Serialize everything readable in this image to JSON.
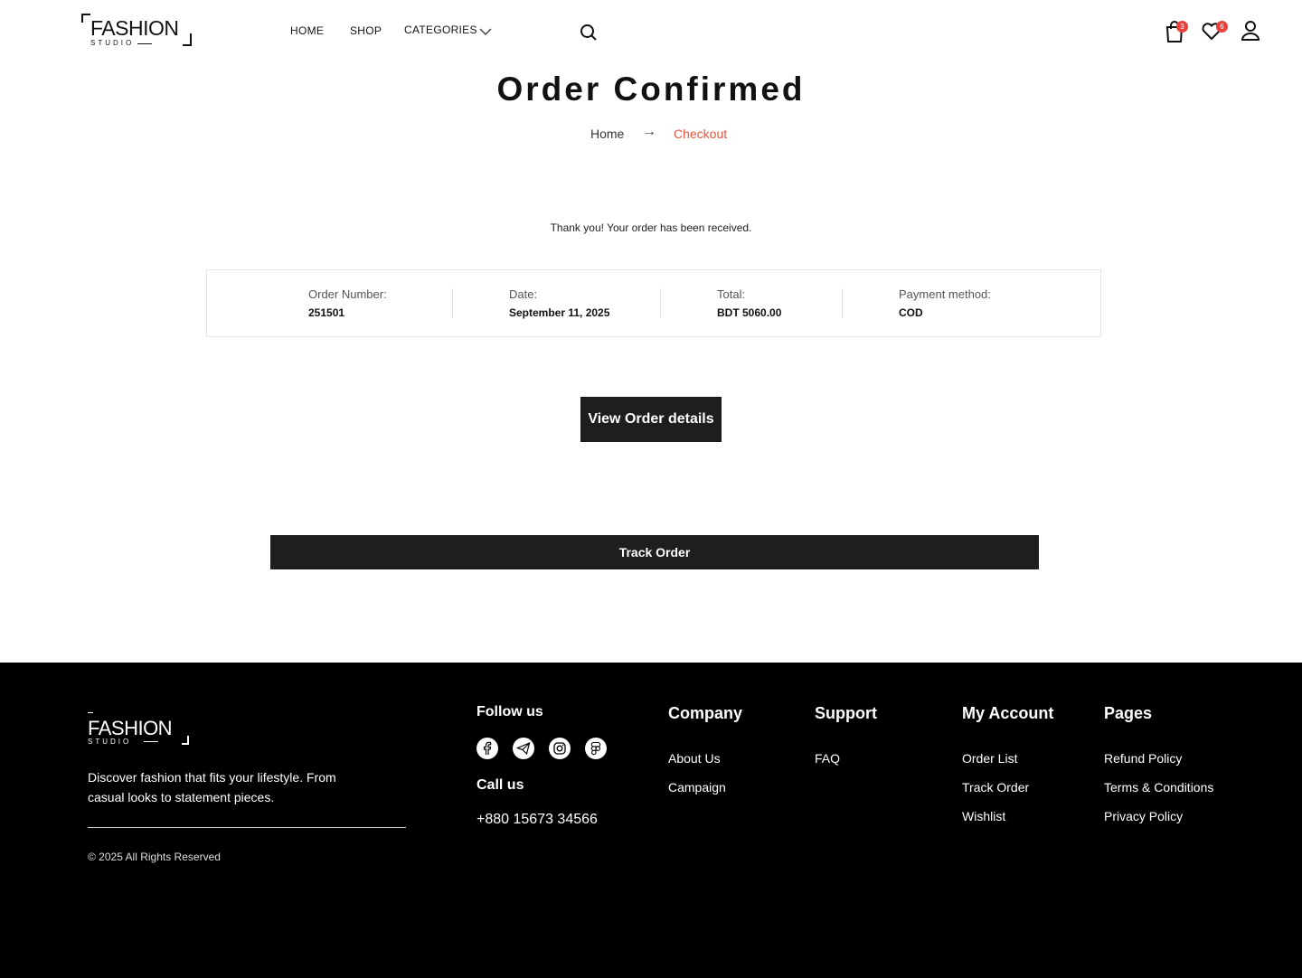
{
  "header": {
    "logo_text": "FASHION",
    "logo_sub": "STUDIO",
    "nav": {
      "home": "HOME",
      "shop": "SHOP",
      "categories": "CATEGORIES"
    },
    "cart_count": "3",
    "wishlist_count": "6",
    "icons": [
      "search-icon",
      "cart-icon",
      "heart-icon",
      "user-icon",
      "chevron-down-icon"
    ]
  },
  "page": {
    "title": "Order Confirmed",
    "breadcrumb": {
      "home": "Home",
      "separator": "→",
      "current": "Checkout"
    },
    "thank_you": "Thank you! Your order has been received.",
    "summary": {
      "order_number_label": "Order Number:",
      "order_number": "251501",
      "date_label": "Date:",
      "date": "September 11, 2025",
      "total_label": "Total:",
      "total": "BDT 5060.00",
      "payment_label": "Payment method:",
      "payment": "COD"
    },
    "view_details_label": "View Order details",
    "track_order_label": "Track Order"
  },
  "footer": {
    "logo_text": "FASHION",
    "logo_sub": "STUDIO",
    "description": "Discover fashion that fits your lifestyle. From casual looks to statement pieces.",
    "copyright": "© 2025 All Rights Reserved",
    "follow_heading": "Follow us",
    "social_icons": [
      "facebook-icon",
      "telegram-icon",
      "instagram-icon",
      "figma-icon"
    ],
    "call_heading": "Call us",
    "phone": "+880 15673 34566",
    "columns": {
      "company": {
        "heading": "Company",
        "links": [
          "About Us",
          "Campaign"
        ]
      },
      "support": {
        "heading": "Support",
        "links": [
          "FAQ"
        ]
      },
      "account": {
        "heading": "My Account",
        "links": [
          "Order List",
          "Track Order",
          "Wishlist"
        ]
      },
      "pages": {
        "heading": "Pages",
        "links": [
          "Refund Policy",
          "Terms & Conditions",
          "Privacy Policy"
        ]
      }
    }
  },
  "colors": {
    "accent": "#e8533d",
    "badge": "#e8403a",
    "dark": "#1e1e1e"
  }
}
